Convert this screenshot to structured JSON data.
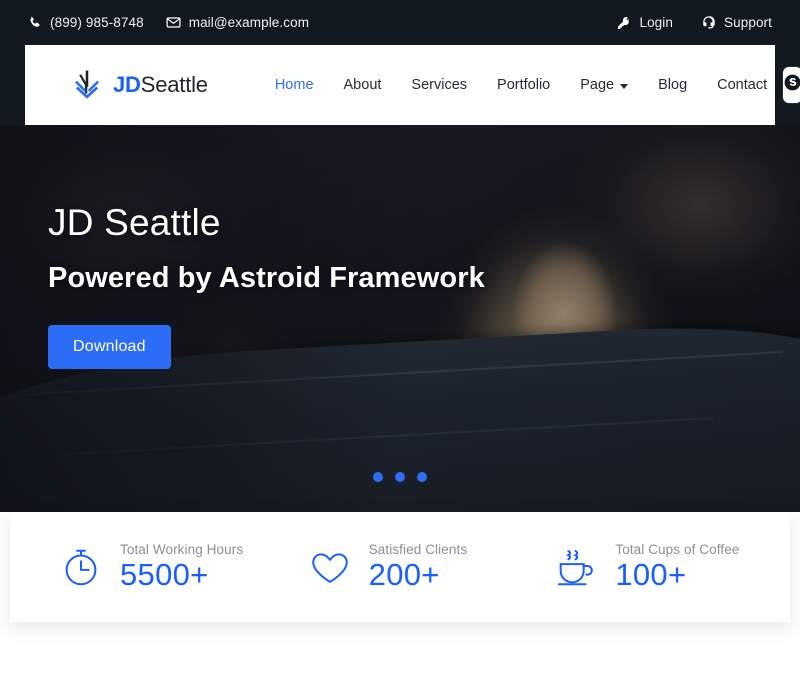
{
  "topbar": {
    "phone": "(899) 985-8748",
    "phone_icon": "phone-icon",
    "email": "mail@example.com",
    "email_icon": "envelope-icon",
    "login": "Login",
    "login_icon": "key-icon",
    "support": "Support",
    "support_icon": "headset-icon",
    "bg_color": "#111820"
  },
  "header": {
    "logo": {
      "mark": "chevron-arrow-logo-mark",
      "brand_bold": "JD",
      "brand_rest": "Seattle"
    },
    "nav": [
      {
        "label": "Home",
        "active": true,
        "dropdown": false
      },
      {
        "label": "About",
        "active": false,
        "dropdown": false
      },
      {
        "label": "Services",
        "active": false,
        "dropdown": false
      },
      {
        "label": "Portfolio",
        "active": false,
        "dropdown": false
      },
      {
        "label": "Page",
        "active": false,
        "dropdown": true
      },
      {
        "label": "Blog",
        "active": false,
        "dropdown": false
      },
      {
        "label": "Contact",
        "active": false,
        "dropdown": false
      }
    ],
    "action_button": {
      "icon": "skype-icon",
      "label": "Skype"
    },
    "active_color": "#2f6df6",
    "text_color": "#252b33"
  },
  "hero": {
    "title": "JD Seattle",
    "subtitle": "Powered by Astroid Framework",
    "cta_label": "Download",
    "cta_color": "#2c6df5",
    "carousel": {
      "total": 3,
      "active_index": 0
    }
  },
  "stats": [
    {
      "icon": "stopwatch-icon",
      "label": "Total Working Hours",
      "value": "5500+"
    },
    {
      "icon": "heart-icon",
      "label": "Satisfied Clients",
      "value": "200+"
    },
    {
      "icon": "coffee-cup-icon",
      "label": "Total Cups of Coffee",
      "value": "100+"
    }
  ],
  "theme": {
    "accent": "#1a5fff",
    "accent_alt": "#2f6df6",
    "dark": "#111820",
    "muted_text": "#8a8f99"
  }
}
